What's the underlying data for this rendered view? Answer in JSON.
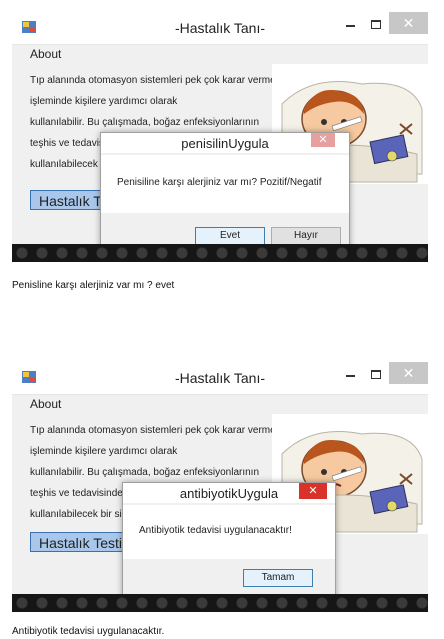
{
  "window": {
    "title": "-Hastalık Tanı-",
    "close_glyph": "✕",
    "menu_about": "About",
    "description_lines": [
      "Tıp alanında otomasyon sistemleri pek çok karar verme",
      "işleminde kişilere yardımcı olarak",
      "kullanılabilir. Bu çalışmada, boğaz enfeksiyonlarının",
      "teşhis ve tedavisinde",
      "kullanılabilecek bir sistem"
    ],
    "test_button": "Hastalık Testi"
  },
  "dialog1": {
    "title": "penisilinUygula",
    "message": "Penisiline karşı alerjiniz var mı? Pozitif/Negatif",
    "yes_button": "Evet",
    "no_button": "Hayır",
    "close_glyph": "✕"
  },
  "caption1": "Penisline karşı alerjiniz var mı ? evet",
  "dialog2": {
    "title": "antibiyotikUygula",
    "message": "Antibiyotik tedavisi uygulanacaktır!",
    "ok_button": "Tamam",
    "close_glyph": "✕"
  },
  "caption2": "Antibiyotik tedavisi uygulanacaktır.",
  "colors": {
    "test_button_bg": "#a9c7ea",
    "close_red": "#d9322a",
    "taskbar": "#1a1a1a"
  },
  "icons": [
    "app-icon",
    "minimize-icon",
    "maximize-icon",
    "close-icon",
    "sick-child-illustration"
  ]
}
